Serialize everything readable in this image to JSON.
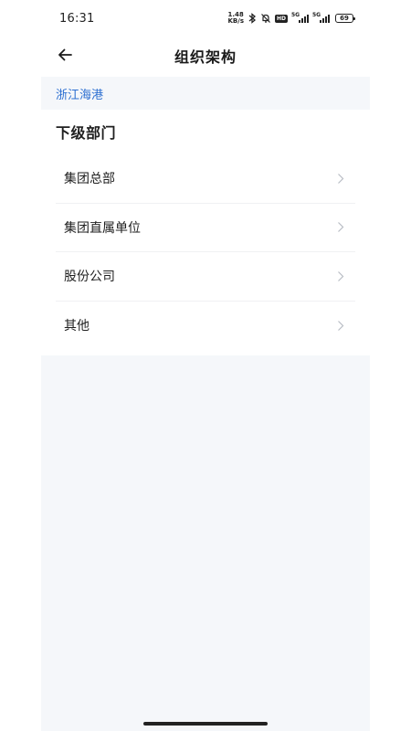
{
  "status_bar": {
    "time": "16:31",
    "net_speed_value": "1.48",
    "net_speed_unit": "KB/s",
    "hd_label": "HD",
    "network_gen_1": "5G",
    "network_gen_2": "5G",
    "battery_level": "69",
    "icons": [
      "bluetooth-icon",
      "mute-bell-icon",
      "signal-icon",
      "signal-icon",
      "battery-icon"
    ]
  },
  "header": {
    "title": "组织架构",
    "back_icon": "arrow-left-icon"
  },
  "breadcrumb": {
    "items": [
      "浙江海港"
    ],
    "color": "#2c6fd1"
  },
  "section": {
    "title": "下级部门",
    "items": [
      {
        "label": "集团总部"
      },
      {
        "label": "集团直属单位"
      },
      {
        "label": "股份公司"
      },
      {
        "label": "其他"
      }
    ],
    "chevron_icon": "chevron-right-icon"
  },
  "colors": {
    "background": "#f5f7fa",
    "card": "#ffffff",
    "link": "#2c6fd1"
  }
}
